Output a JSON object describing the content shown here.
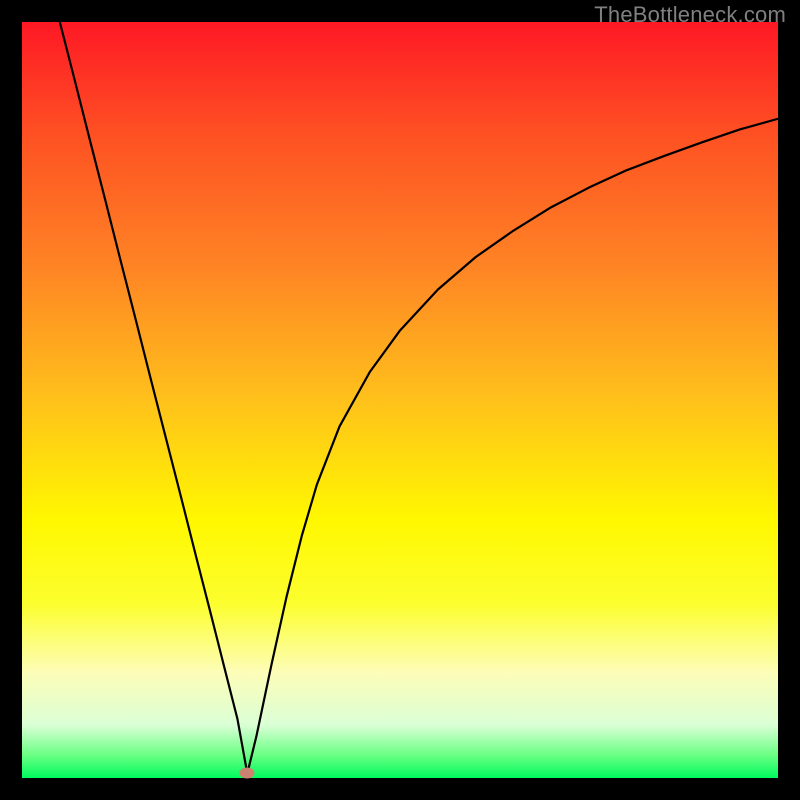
{
  "watermark": "TheBottleneck.com",
  "marker": {
    "x_frac": 0.298,
    "y_frac": 0.994
  },
  "chart_data": {
    "type": "line",
    "title": "",
    "xlabel": "",
    "ylabel": "",
    "xlim": [
      0,
      1
    ],
    "ylim": [
      0,
      1
    ],
    "x": [
      0.05,
      0.07,
      0.09,
      0.11,
      0.13,
      0.15,
      0.17,
      0.19,
      0.21,
      0.23,
      0.25,
      0.27,
      0.285,
      0.298,
      0.31,
      0.33,
      0.35,
      0.37,
      0.39,
      0.42,
      0.46,
      0.5,
      0.55,
      0.6,
      0.65,
      0.7,
      0.75,
      0.8,
      0.85,
      0.9,
      0.95,
      1.0
    ],
    "values": [
      1.0,
      0.922,
      0.843,
      0.765,
      0.686,
      0.608,
      0.529,
      0.451,
      0.373,
      0.294,
      0.216,
      0.137,
      0.078,
      0.006,
      0.055,
      0.15,
      0.24,
      0.32,
      0.388,
      0.465,
      0.537,
      0.592,
      0.646,
      0.689,
      0.724,
      0.755,
      0.781,
      0.804,
      0.823,
      0.841,
      0.858,
      0.872
    ],
    "marker_point": {
      "x": 0.298,
      "y": 0.006
    },
    "background_gradient": {
      "top": "#fe1825",
      "mid": "#fff800",
      "bottom": "#00fa5e"
    }
  }
}
